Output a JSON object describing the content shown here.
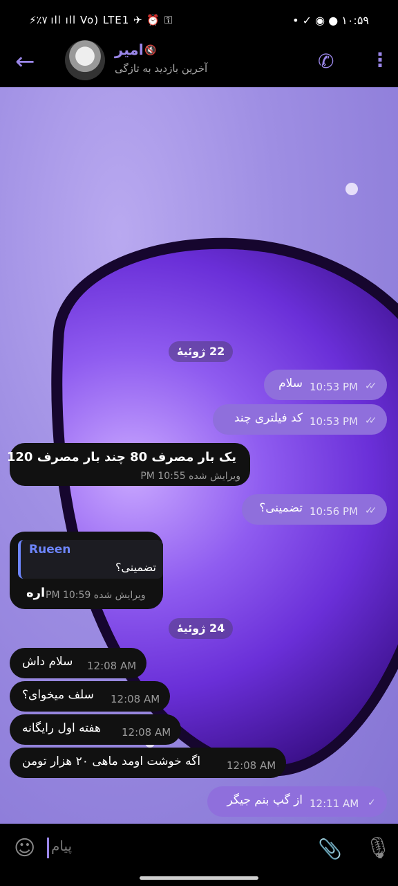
{
  "status_bar": {
    "left_text": "⚡٪۷ ıll ıll Vo) LTE1 ✈ ⏰ ⚿",
    "right_text": "• ✓ ◉ ● ۱۰:۵۹"
  },
  "header": {
    "name": "امیر",
    "subtitle": "آخرین بازدید به تازگی",
    "icons": [
      "back-arrow-icon",
      "mute-icon",
      "phone-icon",
      "more-vertical-icon"
    ]
  },
  "colors": {
    "accent": "#9a86e8",
    "outgoing_bubble": "#8f6fdc",
    "incoming_bubble": "#111111",
    "reply_accent": "#6e86ff"
  },
  "dates": [
    "22 ژوئیهٔ",
    "24 ژوئیهٔ"
  ],
  "messages": [
    {
      "dir": "out",
      "text": "سلام",
      "time": "10:53 PM",
      "status": "read"
    },
    {
      "dir": "out",
      "text": "کد فیلتری چند",
      "time": "10:53 PM",
      "status": "read"
    },
    {
      "dir": "in",
      "text": "یک بار مصرف 80 چند بار مصرف 120",
      "edited_time": "ویرایش شده 10:55 PM"
    },
    {
      "dir": "out",
      "text": "تضمینی؟",
      "time": "10:56 PM",
      "status": "read"
    },
    {
      "dir": "in",
      "reply_name": "Rueen",
      "reply_text": "تضمینی؟",
      "text": "اره",
      "edited_time": "ویرایش شده 10:59 PM"
    },
    {
      "dir": "in",
      "text": "سلام داش",
      "time": "12:08 AM"
    },
    {
      "dir": "in",
      "text": "سلف میخوای؟",
      "time": "12:08 AM"
    },
    {
      "dir": "in",
      "text": "هفته اول رایگانه",
      "time": "12:08 AM"
    },
    {
      "dir": "in",
      "text": "اگه خوشت اومد ماهی ۲۰ هزار تومن",
      "time": "12:08 AM"
    },
    {
      "dir": "out",
      "text": "از گپ بنم جیگر",
      "time": "12:11 AM",
      "status": "sent"
    }
  ],
  "input": {
    "placeholder": "پیام",
    "icons": [
      "emoji-icon",
      "attach-icon",
      "microphone-icon"
    ]
  }
}
